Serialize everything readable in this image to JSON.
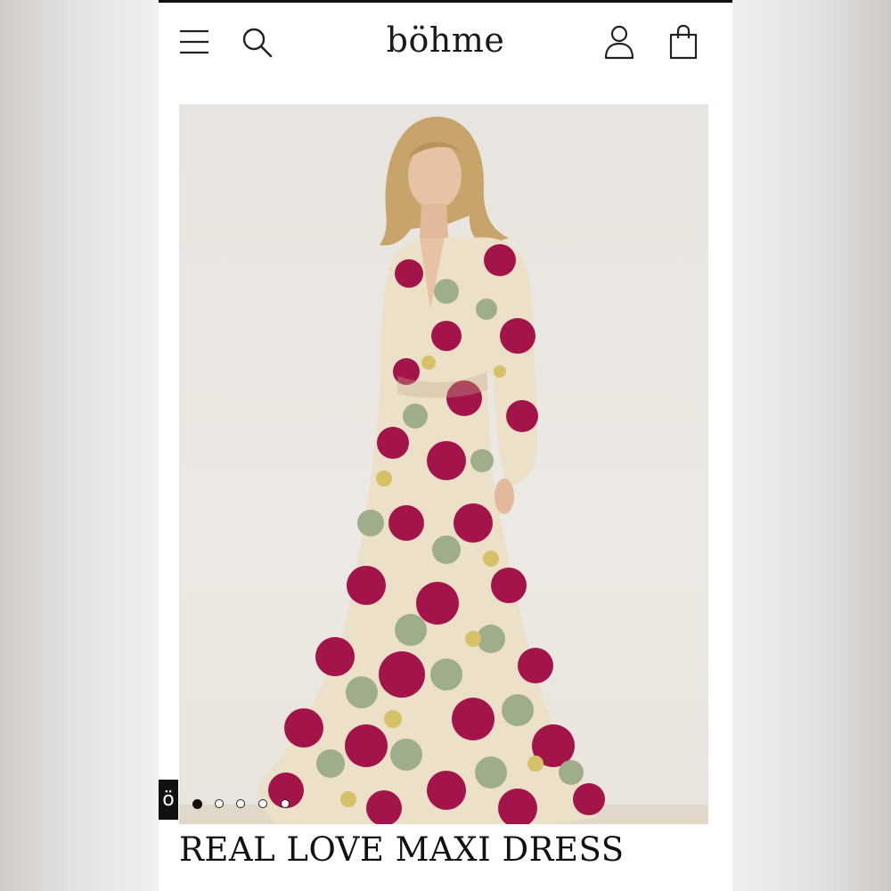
{
  "header": {
    "brand": "böhme",
    "menu_icon": "hamburger-menu-icon",
    "search_icon": "search-icon",
    "account_icon": "account-icon",
    "bag_icon": "shopping-bag-icon"
  },
  "gallery": {
    "image": "model wearing floral print long-sleeve maxi dress",
    "badge": "ö",
    "slides": 5,
    "active_slide": 1
  },
  "product": {
    "title": "REAL LOVE MAXI DRESS"
  },
  "colors": {
    "dress_magenta": "#a3154a",
    "dress_cream": "#ece1c8",
    "dress_sage": "#9fae8a"
  }
}
